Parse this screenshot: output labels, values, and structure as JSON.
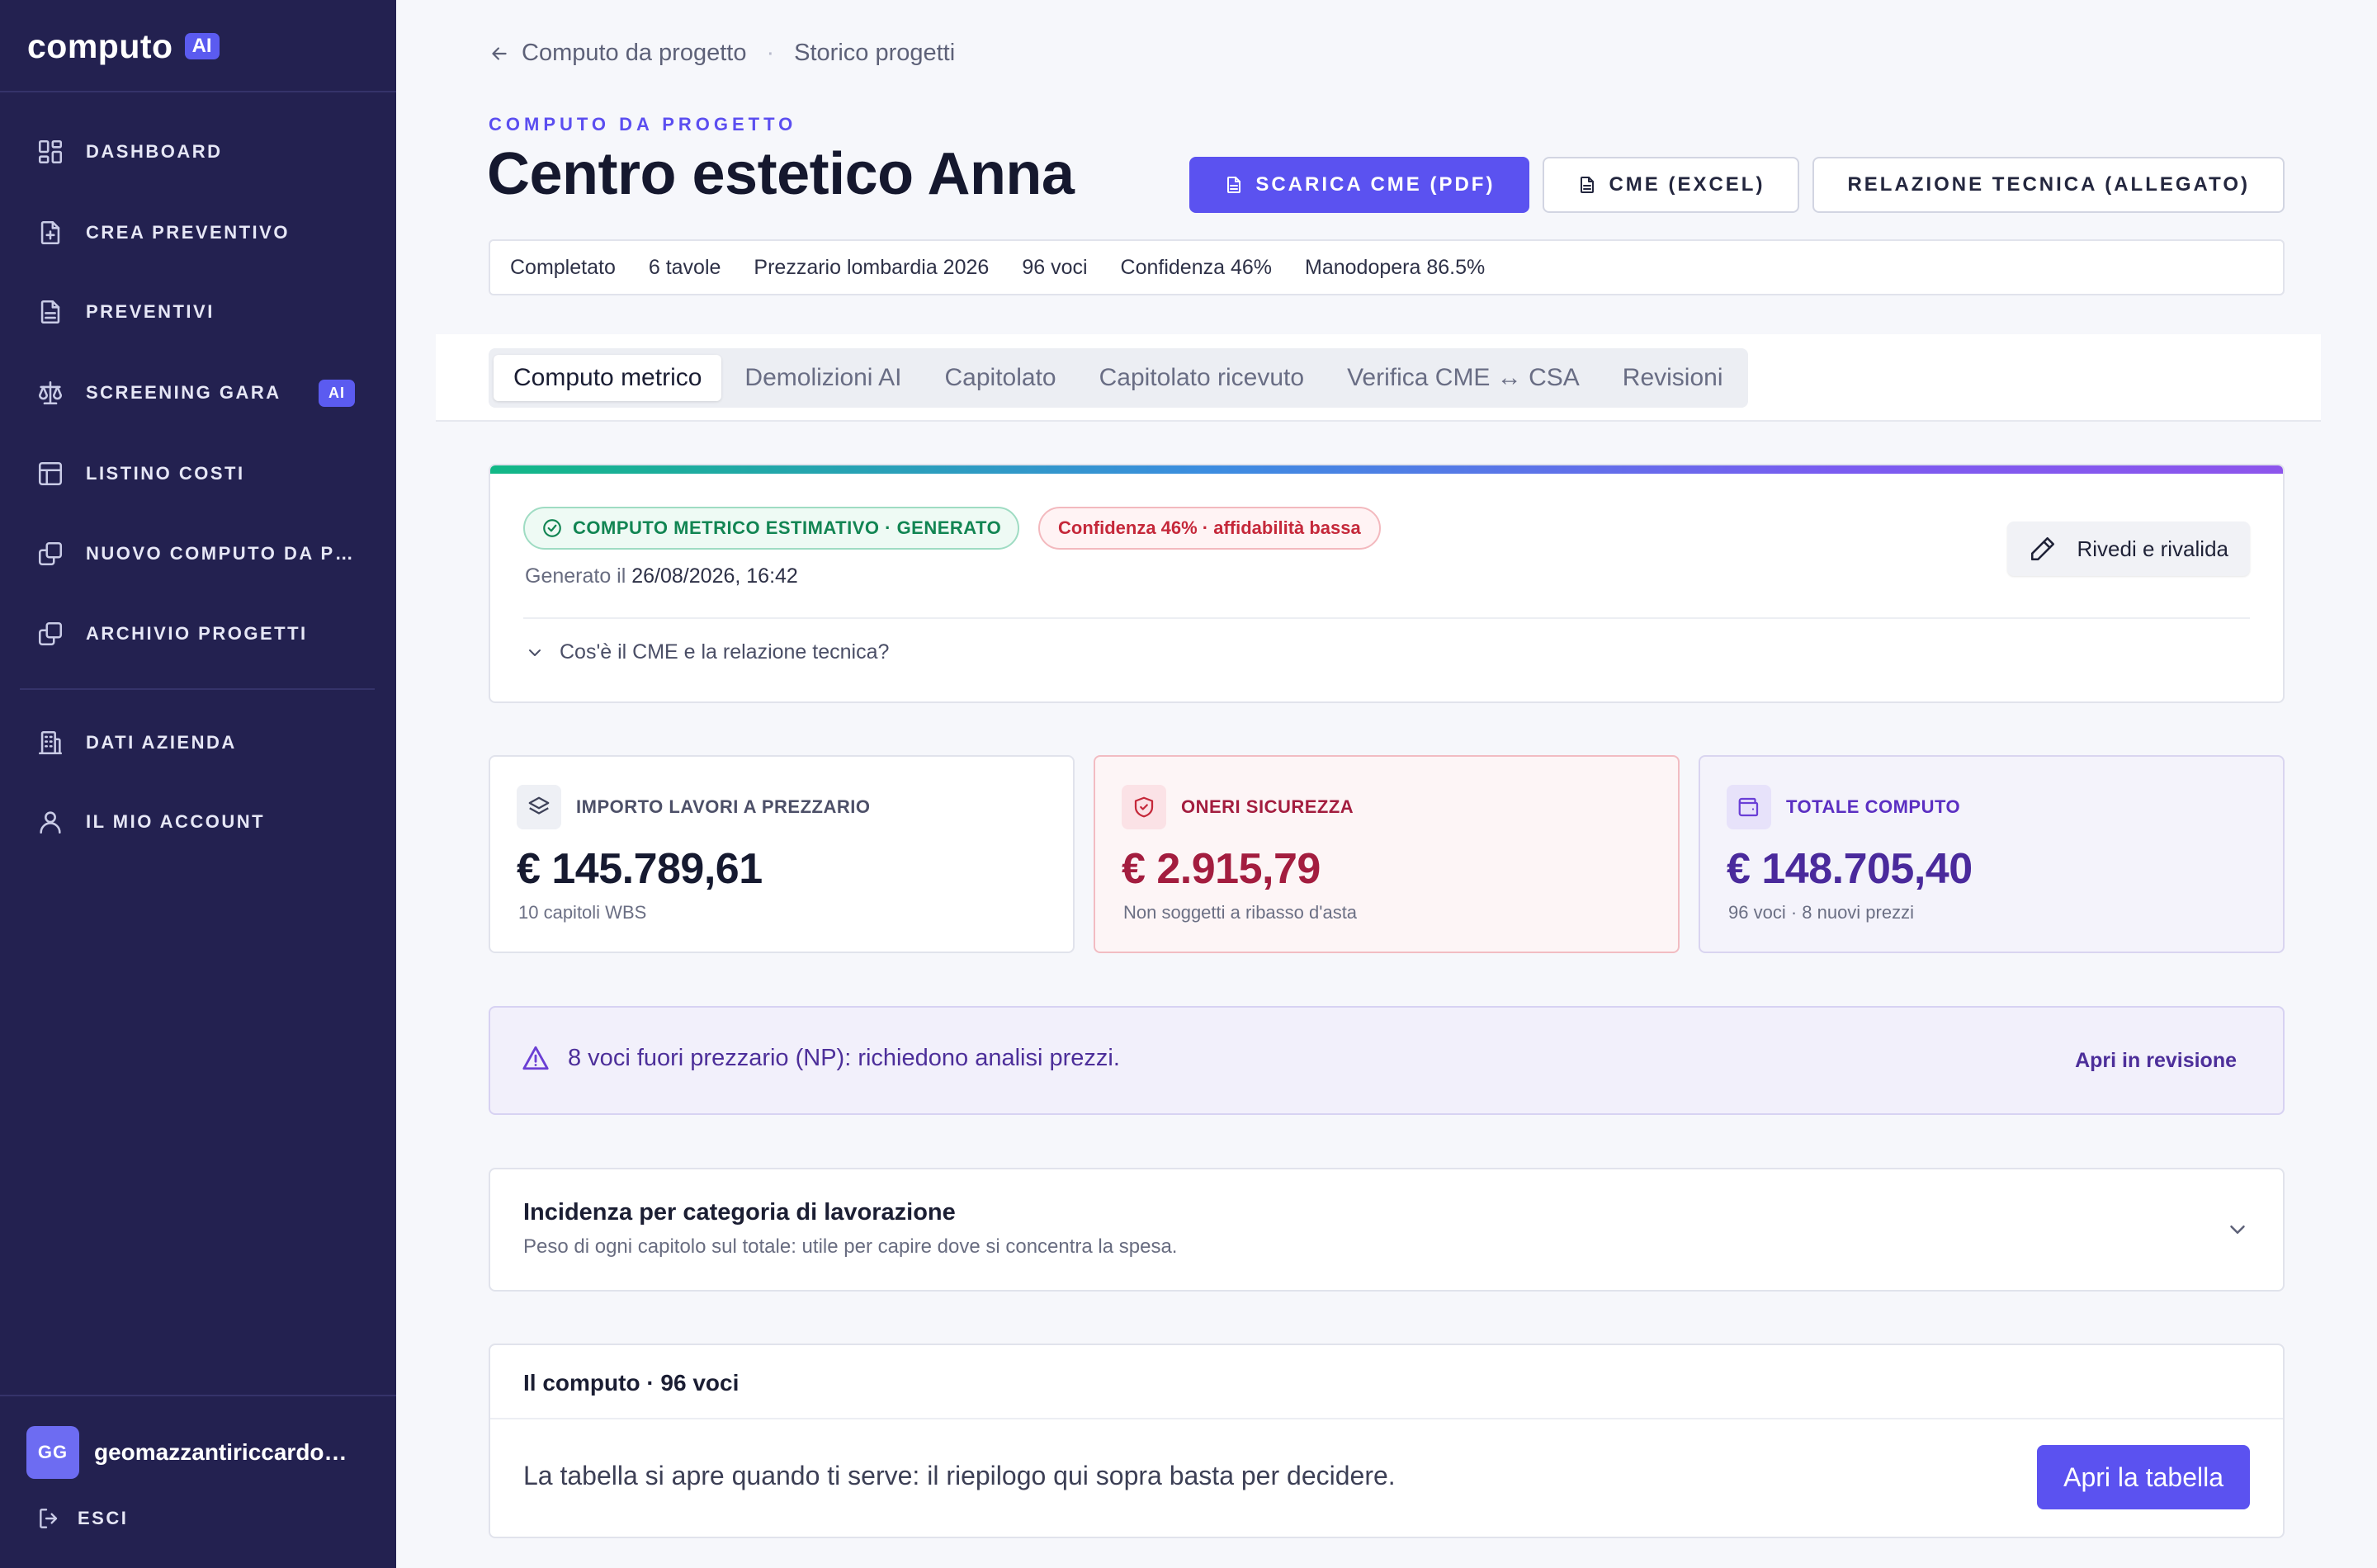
{
  "sidebar": {
    "logo_text": "computo",
    "logo_badge": "AI",
    "items": [
      {
        "label": "DASHBOARD",
        "icon": "dashboard-icon"
      },
      {
        "label": "CREA PREVENTIVO",
        "icon": "file-plus-icon"
      },
      {
        "label": "PREVENTIVI",
        "icon": "file-text-icon"
      },
      {
        "label": "SCREENING GARA",
        "icon": "scale-icon",
        "badge": "AI"
      },
      {
        "label": "LISTINO COSTI",
        "icon": "table-icon"
      },
      {
        "label": "NUOVO COMPUTO DA PROGETTO",
        "icon": "copy-icon"
      },
      {
        "label": "ARCHIVIO PROGETTI",
        "icon": "copy-icon"
      },
      {
        "label": "DATI AZIENDA",
        "icon": "building-icon"
      },
      {
        "label": "IL MIO ACCOUNT",
        "icon": "user-icon"
      }
    ],
    "user": {
      "initials": "GG",
      "name": "geomazzantiriccardo@gmail.com"
    },
    "logout_label": "ESCI"
  },
  "breadcrumb": {
    "back": "Computo da progetto",
    "current": "Storico progetti"
  },
  "header": {
    "eyebrow": "COMPUTO DA PROGETTO",
    "title": "Centro estetico Anna",
    "buttons": {
      "pdf": "SCARICA CME (PDF)",
      "excel": "CME (EXCEL)",
      "relazione": "RELAZIONE TECNICA (ALLEGATO)"
    }
  },
  "meta": [
    "Completato",
    "6 tavole",
    "Prezzario lombardia 2026",
    "96 voci",
    "Confidenza 46%",
    "Manodopera 86.5%"
  ],
  "tabs": [
    "Computo metrico",
    "Demolizioni AI",
    "Capitolato",
    "Capitolato ricevuto",
    "Verifica CME ↔ CSA",
    "Revisioni"
  ],
  "status": {
    "badge": "COMPUTO METRICO ESTIMATIVO · GENERATO",
    "confidence": "Confidenza 46% · affidabilità bassa",
    "generated_label": "Generato il",
    "generated_at": "26/08/2026, 16:42",
    "review_button": "Rivedi e rivalida",
    "faq": "Cos'è il CME e la relazione tecnica?"
  },
  "stats": [
    {
      "label": "IMPORTO LAVORI A PREZZARIO",
      "value": "€ 145.789,61",
      "sub": "10 capitoli WBS",
      "color": "#161a30"
    },
    {
      "label": "ONERI SICUREZZA",
      "value": "€ 2.915,79",
      "sub": "Non soggetti a ribasso d'asta",
      "color": "#a31d3f"
    },
    {
      "label": "TOTALE COMPUTO",
      "value": "€ 148.705,40",
      "sub": "96 voci · 8 nuovi prezzi",
      "color": "#4a2a9c"
    }
  ],
  "warning": {
    "text": "8 voci fuori prezzario (NP): richiedono analisi prezzi.",
    "link": "Apri in revisione"
  },
  "incidence": {
    "title": "Incidenza per categoria di lavorazione",
    "subtitle": "Peso di ogni capitolo sul totale: utile per capire dove si concentra la spesa."
  },
  "computo": {
    "title": "Il computo · 96 voci",
    "text": "La tabella si apre quando ti serve: il riepilogo qui sopra basta per decidere.",
    "button": "Apri la tabella"
  }
}
